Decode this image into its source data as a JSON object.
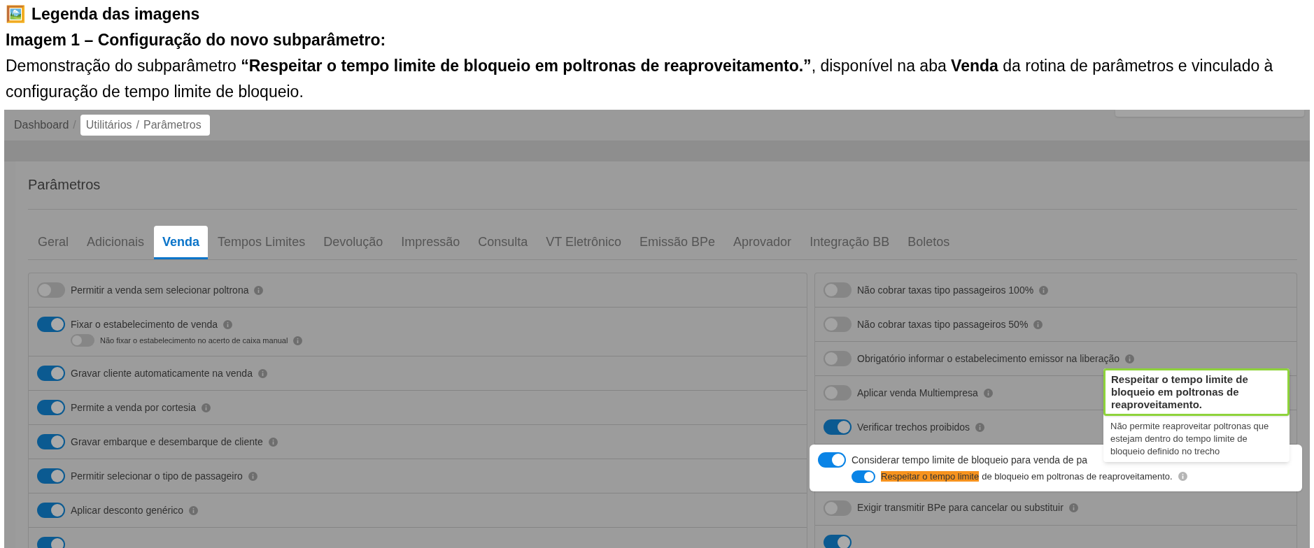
{
  "doc": {
    "heading_icon": "🖼️",
    "heading": "Legenda das imagens",
    "title": "Imagem 1 – Configuração do novo subparâmetro:",
    "description": "Demonstração do subparâmetro **“Respeitar o tempo limite de bloqueio em poltronas de reaproveitamento.”**, disponível na aba **Venda** da rotina de parâmetros e vinculado à configuração de tempo limite de bloqueio."
  },
  "breadcrumb": {
    "separator": "/",
    "items": [
      {
        "label": "Dashboard",
        "highlighted": false
      },
      {
        "label": "Utilitários",
        "highlighted": true
      },
      {
        "label": "Parâmetros",
        "highlighted": true
      }
    ]
  },
  "panel": {
    "title": "Parâmetros"
  },
  "tabs": [
    {
      "label": "Geral",
      "selected": false
    },
    {
      "label": "Adicionais",
      "selected": false
    },
    {
      "label": "Venda",
      "selected": true
    },
    {
      "label": "Tempos Limites",
      "selected": false
    },
    {
      "label": "Devolução",
      "selected": false
    },
    {
      "label": "Impressão",
      "selected": false
    },
    {
      "label": "Consulta",
      "selected": false
    },
    {
      "label": "VT Eletrônico",
      "selected": false
    },
    {
      "label": "Emissão BPe",
      "selected": false
    },
    {
      "label": "Aprovador",
      "selected": false
    },
    {
      "label": "Integração BB",
      "selected": false
    },
    {
      "label": "Boletos",
      "selected": false
    }
  ],
  "left_rows": [
    {
      "label": "Permitir a venda sem selecionar poltrona",
      "on": false,
      "highlighted": false
    },
    {
      "label": "Fixar o estabelecimento de venda",
      "on": true,
      "highlighted": false,
      "sub": {
        "label": "Não fixar o estabelecimento no acerto de caixa manual",
        "on": false
      }
    },
    {
      "label": "Gravar cliente automaticamente na venda",
      "on": true,
      "highlighted": false
    },
    {
      "label": "Permite a venda por cortesia",
      "on": true,
      "highlighted": false
    },
    {
      "label": "Gravar embarque e desembarque de cliente",
      "on": true,
      "highlighted": false
    },
    {
      "label": "Permitir selecionar o tipo de passageiro",
      "on": true,
      "highlighted": false
    },
    {
      "label": "Aplicar desconto genérico",
      "on": true,
      "highlighted": false
    },
    {
      "on": true,
      "highlighted": false
    }
  ],
  "right_rows": [
    {
      "label": "Não cobrar taxas tipo passageiros 100%",
      "on": false,
      "highlighted": false
    },
    {
      "label": "Não cobrar taxas tipo passageiros 50%",
      "on": false,
      "highlighted": false
    },
    {
      "label": "Obrigatório informar o estabelecimento emissor na liberação",
      "on": false,
      "highlighted": false
    },
    {
      "label": "Aplicar venda Multiempresa",
      "on": false,
      "highlighted": false
    },
    {
      "label": "Verificar trechos proibidos",
      "on": true,
      "highlighted": false
    },
    {
      "label": "Considerar tempo limite de bloqueio para venda de pa",
      "on": true,
      "highlighted": true,
      "sub": {
        "highlight": "Respeitar o tempo limite",
        "label": "de bloqueio em poltronas de reaproveitamento.",
        "on": true
      }
    },
    {
      "label": "Exigir transmitir BPe para cancelar ou substituir",
      "on": false,
      "highlighted": false
    },
    {
      "on": true,
      "highlighted": false
    }
  ],
  "tooltip": {
    "title": "Respeitar o tempo limite de bloqueio em poltronas de reaproveitamento.",
    "text": "Não permite reaproveitar poltronas que estejam dentro do tempo limite de bloqueio definido no trecho"
  }
}
